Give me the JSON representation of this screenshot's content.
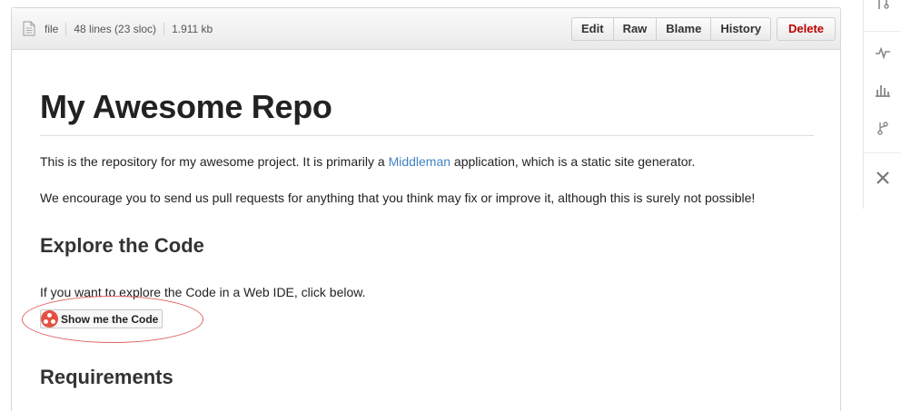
{
  "file_header": {
    "icon": "file-icon",
    "type": "file",
    "lines": "48 lines (23 sloc)",
    "size": "1.911 kb",
    "buttons": {
      "edit": "Edit",
      "raw": "Raw",
      "blame": "Blame",
      "history": "History",
      "delete": "Delete"
    }
  },
  "readme": {
    "title": "My Awesome Repo",
    "intro_before": "This is the repository for my awesome project. It is primarily a ",
    "intro_link": "Middleman",
    "intro_after": " application, which is a static site generator.",
    "paragraph2": "We encourage you to send us pull requests for anything that you think may fix or improve it, although this is surely not possible!",
    "section1": "Explore the Code",
    "paragraph3": "If you want to explore the Code in a Web IDE, click below.",
    "code_button": "Show me the Code",
    "section2": "Requirements"
  },
  "sidebar": {
    "icons": [
      "pull-request-icon",
      "pulse-icon",
      "graphs-icon",
      "network-icon",
      "settings-icon"
    ]
  },
  "colors": {
    "link": "#4183c4",
    "delete": "#bb0000",
    "highlight": "#e06666",
    "logo": "#e55040"
  }
}
